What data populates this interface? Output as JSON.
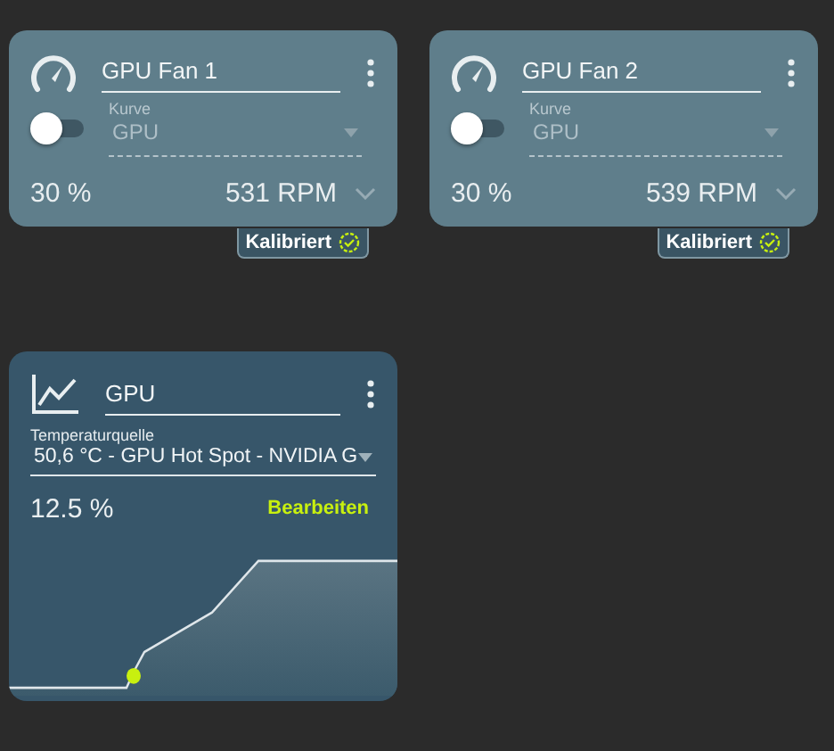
{
  "fans": [
    {
      "name": "GPU Fan 1",
      "on": false,
      "curve_label": "Kurve",
      "curve": "GPU",
      "percent": "30 %",
      "rpm": "531 RPM",
      "badge": "Kalibriert"
    },
    {
      "name": "GPU Fan 2",
      "on": false,
      "curve_label": "Kurve",
      "curve": "GPU",
      "percent": "30 %",
      "rpm": "539 RPM",
      "badge": "Kalibriert"
    }
  ],
  "curve_card": {
    "name": "GPU",
    "source_label": "Temperaturquelle",
    "source": "50,6 °C - GPU Hot Spot - NVIDIA G",
    "value": "12.5 %",
    "edit": "Bearbeiten"
  }
}
